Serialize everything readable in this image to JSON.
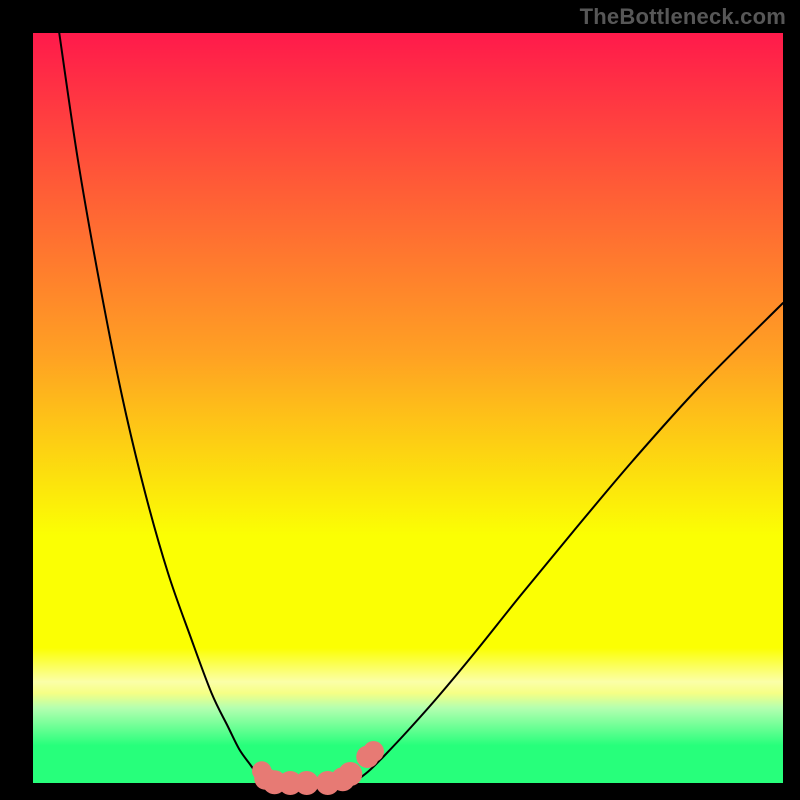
{
  "watermark": {
    "text": "TheBottleneck.com"
  },
  "colors": {
    "red": "#ff1a4b",
    "orange": "#ffa123",
    "yellow": "#fbff03",
    "pale_yellow": "#fbffa8",
    "green": "#27ff7b",
    "marker_fill": "#e77a74",
    "curve_stroke": "#000000"
  },
  "gradient_css": "background: linear-gradient(to bottom, #ff1a4b 0%, #ff5a37 20%, #ffa123 43%, #fbff03 67%, #fbff03 82%, #fbffa8 86.5%, #f6ff85 88%, #b4ffb0 90%, #27ff7b 95%, #27ff7b 100%);",
  "chart_data": {
    "type": "line",
    "title": "",
    "xlabel": "",
    "ylabel": "",
    "xlim": [
      0,
      100
    ],
    "ylim": [
      0,
      100
    ],
    "grid": false,
    "legend": false,
    "series": [
      {
        "name": "left-branch",
        "x": [
          3.5,
          6.0,
          9.0,
          12.0,
          15.0,
          18.0,
          21.0,
          23.8,
          26.0,
          27.5,
          29.0,
          30.0,
          30.5,
          30.3,
          30.0
        ],
        "y": [
          100.0,
          83.0,
          66.0,
          51.0,
          38.5,
          28.0,
          19.5,
          12.0,
          7.5,
          4.5,
          2.4,
          1.0,
          0.2,
          0.0,
          0.0
        ]
      },
      {
        "name": "trough",
        "x": [
          30.0,
          31.5,
          33.5,
          36.0,
          39.0,
          41.5,
          42.5
        ],
        "y": [
          0.0,
          0.0,
          0.0,
          0.0,
          0.0,
          0.0,
          0.0
        ]
      },
      {
        "name": "right-branch",
        "x": [
          42.5,
          43.5,
          45.0,
          47.0,
          50.0,
          54.0,
          59.0,
          65.0,
          72.0,
          80.0,
          89.0,
          100.0
        ],
        "y": [
          0.0,
          0.6,
          1.8,
          3.8,
          7.0,
          11.5,
          17.5,
          25.0,
          33.5,
          43.0,
          53.0,
          64.0
        ]
      }
    ],
    "markers": [
      {
        "series": "trough",
        "x": 30.5,
        "y": 1.6,
        "r": 1.3
      },
      {
        "series": "trough",
        "x": 31.0,
        "y": 0.6,
        "r": 1.5
      },
      {
        "series": "trough",
        "x": 32.2,
        "y": 0.1,
        "r": 1.6
      },
      {
        "series": "trough",
        "x": 34.3,
        "y": 0.0,
        "r": 1.6
      },
      {
        "series": "trough",
        "x": 36.5,
        "y": 0.0,
        "r": 1.6
      },
      {
        "series": "trough",
        "x": 39.3,
        "y": 0.0,
        "r": 1.6
      },
      {
        "series": "trough",
        "x": 41.3,
        "y": 0.5,
        "r": 1.6
      },
      {
        "series": "trough",
        "x": 42.3,
        "y": 1.2,
        "r": 1.6
      },
      {
        "series": "trough",
        "x": 44.6,
        "y": 3.5,
        "r": 1.5
      },
      {
        "series": "trough",
        "x": 45.4,
        "y": 4.2,
        "r": 1.4
      }
    ],
    "annotations": []
  }
}
